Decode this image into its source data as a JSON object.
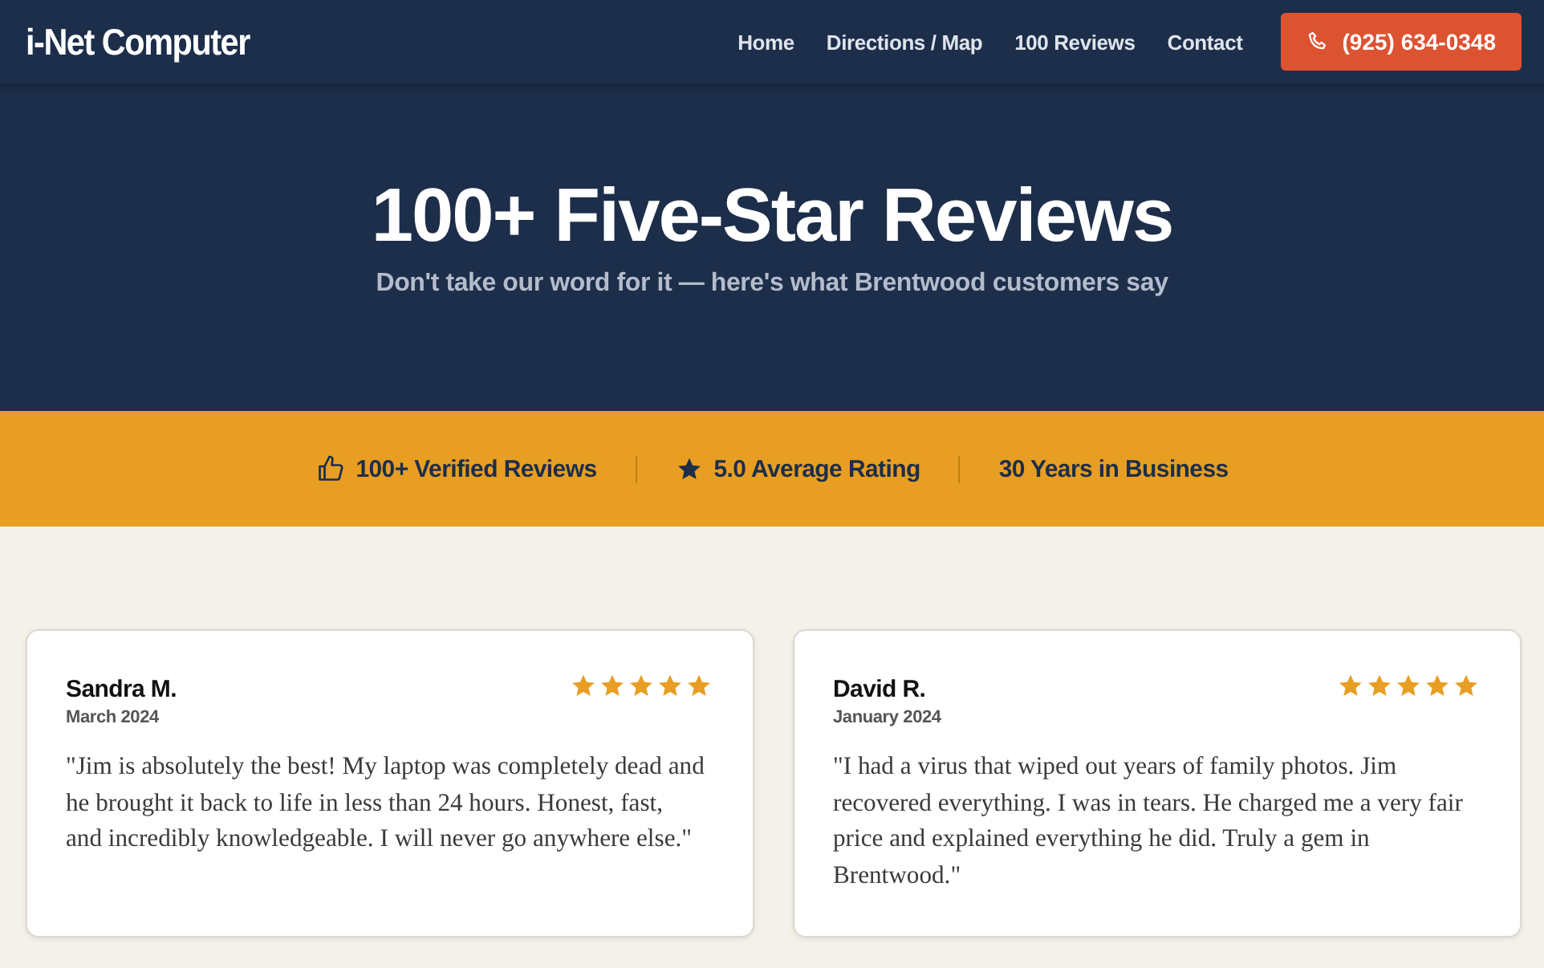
{
  "header": {
    "logo": "i-Net Computer",
    "nav": [
      {
        "label": "Home"
      },
      {
        "label": "Directions / Map"
      },
      {
        "label": "100 Reviews"
      },
      {
        "label": "Contact"
      }
    ],
    "phone_button": "(925) 634-0348"
  },
  "hero": {
    "title": "100+ Five-Star Reviews",
    "subtitle": "Don't take our word for it — here's what Brentwood customers say"
  },
  "stats": [
    {
      "kind": "thumb",
      "label": "100+ Verified Reviews"
    },
    {
      "kind": "star",
      "label": "5.0 Average Rating"
    },
    {
      "kind": "none",
      "label": "30 Years in Business"
    }
  ],
  "reviews": [
    {
      "name": "Sandra M.",
      "date": "March 2024",
      "stars": 5,
      "text": "\"Jim is absolutely the best! My laptop was completely dead and he brought it back to life in less than 24 hours. Honest, fast, and incredibly knowledgeable. I will never go anywhere else.\""
    },
    {
      "name": "David R.",
      "date": "January 2024",
      "stars": 5,
      "text": "\"I had a virus that wiped out years of family photos. Jim recovered everything. I was in tears. He charged me a very fair price and explained everything he did. Truly a gem in Brentwood.\""
    }
  ]
}
